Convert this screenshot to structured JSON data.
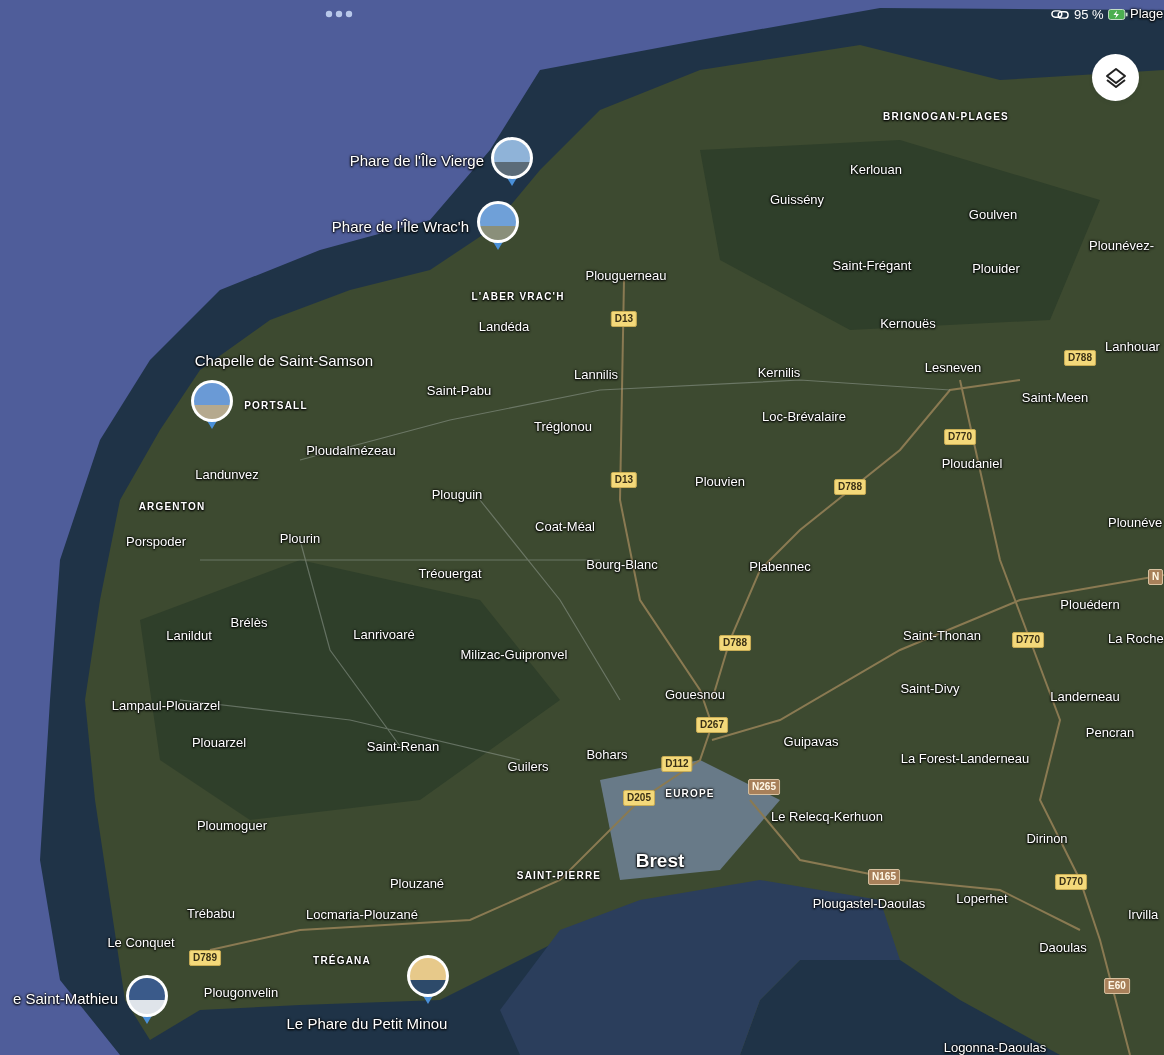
{
  "status_bar": {
    "battery_text": "95 %",
    "edge_label": "Plage"
  },
  "landmarks": [
    {
      "name": "Phare de l'Île Vierge"
    },
    {
      "name": "Phare de l'Île Wrac'h"
    },
    {
      "name": "Chapelle de Saint-Samson"
    },
    {
      "name": "e Saint-Mathieu"
    },
    {
      "name": "Le Phare du Petit Minou"
    }
  ],
  "labels": [
    {
      "text": "BRIGNOGAN-PLAGES",
      "kind": "district"
    },
    {
      "text": "Kerlouan",
      "kind": "town"
    },
    {
      "text": "Guissény",
      "kind": "town"
    },
    {
      "text": "Goulven",
      "kind": "town"
    },
    {
      "text": "Plounévez-",
      "kind": "town"
    },
    {
      "text": "Plouguerneau",
      "kind": "town"
    },
    {
      "text": "Saint-Frégant",
      "kind": "town"
    },
    {
      "text": "Plouider",
      "kind": "town"
    },
    {
      "text": "L'ABER VRAC'H",
      "kind": "district"
    },
    {
      "text": "D13",
      "kind": "road"
    },
    {
      "text": "Landéda",
      "kind": "town"
    },
    {
      "text": "Kernouës",
      "kind": "town"
    },
    {
      "text": "Lannilis",
      "kind": "town"
    },
    {
      "text": "Kernilis",
      "kind": "town"
    },
    {
      "text": "Lesneven",
      "kind": "town"
    },
    {
      "text": "D788",
      "kind": "road"
    },
    {
      "text": "Lanhouar",
      "kind": "town"
    },
    {
      "text": "Saint-Pabu",
      "kind": "town"
    },
    {
      "text": "PORTSALL",
      "kind": "district"
    },
    {
      "text": "Saint-Meen",
      "kind": "town"
    },
    {
      "text": "Tréglonou",
      "kind": "town"
    },
    {
      "text": "Loc-Brévalaire",
      "kind": "town"
    },
    {
      "text": "D770",
      "kind": "road"
    },
    {
      "text": "Ploudalmézeau",
      "kind": "town"
    },
    {
      "text": "Landunvez",
      "kind": "town"
    },
    {
      "text": "Ploudaniel",
      "kind": "town"
    },
    {
      "text": "Plouguin",
      "kind": "town"
    },
    {
      "text": "D13",
      "kind": "road"
    },
    {
      "text": "Plouvien",
      "kind": "town"
    },
    {
      "text": "D788",
      "kind": "road"
    },
    {
      "text": "ARGENTON",
      "kind": "district"
    },
    {
      "text": "Plounéve",
      "kind": "town"
    },
    {
      "text": "Coat-Méal",
      "kind": "town"
    },
    {
      "text": "Porspoder",
      "kind": "town"
    },
    {
      "text": "Plourin",
      "kind": "town"
    },
    {
      "text": "Tréouergat",
      "kind": "town"
    },
    {
      "text": "Bourg-Blanc",
      "kind": "town"
    },
    {
      "text": "Plabennec",
      "kind": "town"
    },
    {
      "text": "N",
      "kind": "national"
    },
    {
      "text": "Plouédern",
      "kind": "town"
    },
    {
      "text": "Brélès",
      "kind": "town"
    },
    {
      "text": "Lanildut",
      "kind": "town"
    },
    {
      "text": "Lanrivoaré",
      "kind": "town"
    },
    {
      "text": "Milizac-Guipronvel",
      "kind": "town"
    },
    {
      "text": "D788",
      "kind": "road"
    },
    {
      "text": "Saint-Thonan",
      "kind": "town"
    },
    {
      "text": "D770",
      "kind": "road"
    },
    {
      "text": "La Roche",
      "kind": "town"
    },
    {
      "text": "Gouesnou",
      "kind": "town"
    },
    {
      "text": "Saint-Divy",
      "kind": "town"
    },
    {
      "text": "Landerneau",
      "kind": "town"
    },
    {
      "text": "Lampaul-Plouarzel",
      "kind": "town"
    },
    {
      "text": "D267",
      "kind": "road"
    },
    {
      "text": "Pencran",
      "kind": "town"
    },
    {
      "text": "Plouarzel",
      "kind": "town"
    },
    {
      "text": "Saint-Renan",
      "kind": "town"
    },
    {
      "text": "Guilers",
      "kind": "town"
    },
    {
      "text": "Bohars",
      "kind": "town"
    },
    {
      "text": "D112",
      "kind": "road"
    },
    {
      "text": "Guipavas",
      "kind": "town"
    },
    {
      "text": "La Forest-Landerneau",
      "kind": "town"
    },
    {
      "text": "D205",
      "kind": "road"
    },
    {
      "text": "EUROPE",
      "kind": "district"
    },
    {
      "text": "N265",
      "kind": "national"
    },
    {
      "text": "Ploumoguer",
      "kind": "town"
    },
    {
      "text": "Le Relecq-Kerhuon",
      "kind": "town"
    },
    {
      "text": "Dirinon",
      "kind": "town"
    },
    {
      "text": "Brest",
      "kind": "city"
    },
    {
      "text": "Plouzané",
      "kind": "town"
    },
    {
      "text": "SAINT-PIERRE",
      "kind": "district"
    },
    {
      "text": "N165",
      "kind": "national"
    },
    {
      "text": "D770",
      "kind": "road"
    },
    {
      "text": "Trébabu",
      "kind": "town"
    },
    {
      "text": "Locmaria-Plouzané",
      "kind": "town"
    },
    {
      "text": "Plougastel-Daoulas",
      "kind": "town"
    },
    {
      "text": "Loperhet",
      "kind": "town"
    },
    {
      "text": "Irvilla",
      "kind": "town"
    },
    {
      "text": "Le Conquet",
      "kind": "town"
    },
    {
      "text": "D789",
      "kind": "road"
    },
    {
      "text": "TRÉGANA",
      "kind": "district"
    },
    {
      "text": "Daoulas",
      "kind": "town"
    },
    {
      "text": "Plougonvelin",
      "kind": "town"
    },
    {
      "text": "E60",
      "kind": "national"
    },
    {
      "text": "Logonna-Daoulas",
      "kind": "town"
    }
  ]
}
